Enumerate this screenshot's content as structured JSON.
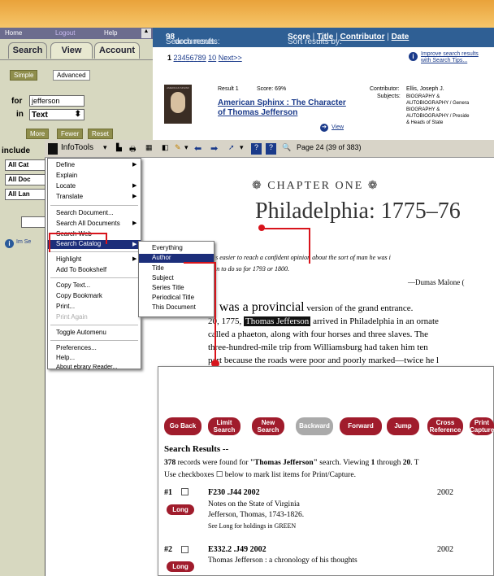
{
  "left_nav": {
    "home": "Home",
    "logout": "Logout",
    "help": "Help"
  },
  "tabs": {
    "search": "Search",
    "view": "View",
    "account": "Account"
  },
  "search_mode": {
    "simple": "Simple",
    "advanced": "Advanced"
  },
  "search_form": {
    "for_label": "for",
    "query_value": "jefferson",
    "in_label": "in",
    "field_value": "Text",
    "more": "More",
    "fewer": "Fewer",
    "reset": "Reset",
    "include_label": "include",
    "include_values": [
      "All Cat",
      "All Doc",
      "All Lan"
    ],
    "partial_link": "Im Se"
  },
  "results_header": {
    "count_text": "Search results:",
    "count": "98",
    "count_suffix": "documents.",
    "sort_label": "Sort results by:",
    "sort_score": "Score",
    "sort_title": "Title",
    "sort_contributor": "Contributor",
    "sort_date": "Date"
  },
  "pagination": {
    "pages": [
      "1",
      "2",
      "3",
      "4",
      "5",
      "6",
      "7",
      "8",
      "9",
      "10"
    ],
    "next": "Next>>"
  },
  "tips": {
    "line1": "Improve search results",
    "line2": "with Search Tips..."
  },
  "result1": {
    "number": "Result 1",
    "score": "Score: 69%",
    "title_line1": "American Sphinx : The Character",
    "title_line2": "of Thomas Jefferson",
    "view": "View",
    "contributor_label": "Contributor:",
    "contributor": "Ellis, Joseph J.",
    "subjects_label": "Subjects:",
    "subjects": [
      "BIOGRAPHY &",
      "AUTOBIOGRAPHY / Genera",
      "BIOGRAPHY &",
      "AUTOBIOGRAPHY / Preside",
      "& Heads of State"
    ],
    "cover_text": "AMERICAN SPHINX"
  },
  "reader_toolbar": {
    "infotools": "InfoTools",
    "page_status": "Page 24 (39 of 383)"
  },
  "infotools_menu": {
    "items": [
      "Define",
      "Explain",
      "Locate",
      "Translate",
      "Search Document...",
      "Search All Documents",
      "Search Web",
      "Search Catalog",
      "Highlight",
      "Add To Bookshelf",
      "Copy Text...",
      "Copy Bookmark",
      "Print...",
      "Print Again",
      "Toggle Automenu",
      "Preferences...",
      "Help...",
      "About ebrary Reader..."
    ]
  },
  "catalog_submenu": {
    "items": [
      "Everything",
      "Author",
      "Title",
      "Subject",
      "Series Title",
      "Periodical Title",
      "This Document"
    ]
  },
  "book_page": {
    "chapter": "CHAPTER ONE",
    "heading": "Philadelphia: 1775–76",
    "epigraph_line1": "It is easier to reach a confident opinion about the sort of man he was i",
    "epigraph_line2": "than to do so for 1793 or 1800.",
    "epigraph_attr": "—Dumas Malone (",
    "body_first": "It was a provincial",
    "body_line1_rest": "version of the grand entrance.",
    "body_line2_pre": "20, 1775,",
    "body_highlight": "Thomas Jefferson",
    "body_line2_post": "arrived in Philadelphia in an ornate",
    "body_line3": "called a phaeton, along with four horses and three slaves. The",
    "body_line4": "three-hundred-mile trip from Williamsburg had taken him ten",
    "body_line5": "part because the roads were poor and poorly marked—twice he l"
  },
  "catalog_window": {
    "buttons": [
      "Go Back",
      "Limit Search",
      "New Search",
      "Backward",
      "Forward",
      "Jump",
      "Cross Reference",
      "Print Capture"
    ],
    "heading": "Search Results --",
    "summary_count": "378",
    "summary_pre": "records were found for",
    "summary_query": "\"Thomas Jefferson\"",
    "summary_post": "search. Viewing",
    "summary_from": "1",
    "summary_through": "through",
    "summary_to": "20",
    "summary_end": ". T",
    "checkbox_note": "Use checkboxes ☐ below to mark list items for Print/Capture.",
    "records": [
      {
        "num": "#1",
        "call": "F230 .J44 2002",
        "year": "2002",
        "long": "Long",
        "title": "Notes on the State of Virginia",
        "author": "Jefferson, Thomas, 1743-1826.",
        "holdings": "See Long for holdings in GREEN"
      },
      {
        "num": "#2",
        "call": "E332.2 .J49 2002",
        "year": "2002",
        "long": "Long",
        "title": "Thomas Jefferson : a chronology of his thoughts",
        "author": "",
        "holdings": ""
      }
    ]
  }
}
